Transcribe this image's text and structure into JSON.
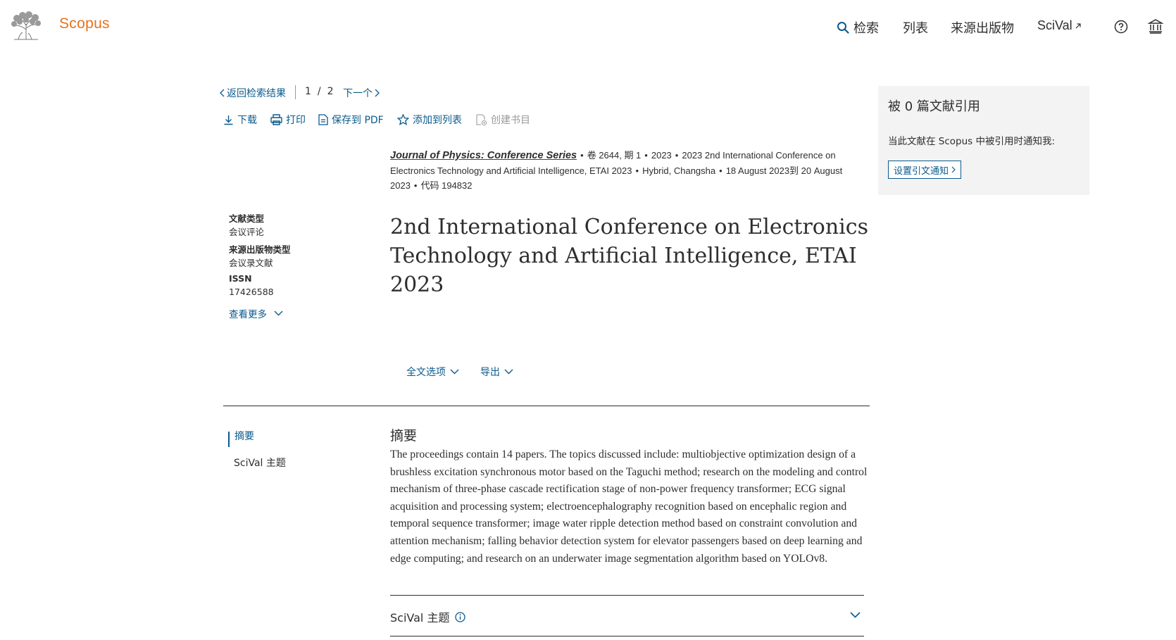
{
  "header": {
    "brand": "Scopus",
    "nav": {
      "search": "检索",
      "lists": "列表",
      "sources": "来源出版物",
      "scival": "SciVal"
    }
  },
  "breadcrumb": {
    "back": "返回检索结果",
    "current": "1",
    "separator": "/",
    "total": "2",
    "next": "下一个"
  },
  "toolbar": {
    "download": "下载",
    "print": "打印",
    "save_pdf": "保存到 PDF",
    "add_to_list": "添加到列表",
    "create_bib": "创建书目"
  },
  "source": {
    "journal": "Journal of Physics: Conference Series",
    "volume": "卷 2644, 期 1",
    "year": "2023",
    "conference": "2023 2nd International Conference on Electronics Technology and Artificial Intelligence, ETAI 2023",
    "location": "Hybrid, Changsha",
    "dates": "18 August 2023到 20 August 2023",
    "code": "代码 194832"
  },
  "meta": {
    "doc_type_label": "文献类型",
    "doc_type_value": "会议评论",
    "source_type_label": "来源出版物类型",
    "source_type_value": "会议录文献",
    "issn_label": "ISSN",
    "issn_value": "17426588",
    "see_more": "查看更多"
  },
  "title": "2nd International Conference on Electronics Technology and Artificial Intelligence, ETAI 2023",
  "options": {
    "full_text": "全文选项",
    "export": "导出"
  },
  "side_nav": {
    "abstract": "摘要",
    "scival_topic": "SciVal 主题"
  },
  "abstract": {
    "heading": "摘要",
    "text": "The proceedings contain 14 papers. The topics discussed include: multiobjective optimization design of a brushless excitation synchronous motor based on the Taguchi method; research on the modeling and control mechanism of three-phase cascade rectification stage of non-power frequency transformer; ECG signal acquisition and processing system; electroencephalography recognition based on encephalic region and temporal sequence transformer; image water ripple detection method based on constraint convolution and attention mechanism; falling behavior detection system for elevator passengers based on deep learning and edge computing; and research on an underwater image segmentation algorithm based on YOLOv8."
  },
  "scival_section": {
    "label": "SciVal 主题"
  },
  "citations": {
    "title": "被 0 篇文献引用",
    "note": "当此文献在 Scopus 中被引用时通知我:",
    "button": "设置引文通知"
  },
  "colors": {
    "accent": "#0a5a8c",
    "brand": "#e9711c",
    "panel_bg": "#f3f3f3",
    "text": "#2e2e2e"
  },
  "icons": [
    "elsevier-tree-logo",
    "search-icon",
    "external-link-icon",
    "help-icon",
    "institution-icon",
    "chevron-left-icon",
    "chevron-right-icon",
    "download-icon",
    "print-icon",
    "pdf-icon",
    "star-icon",
    "bibliography-icon",
    "chevron-down-icon",
    "info-icon"
  ]
}
